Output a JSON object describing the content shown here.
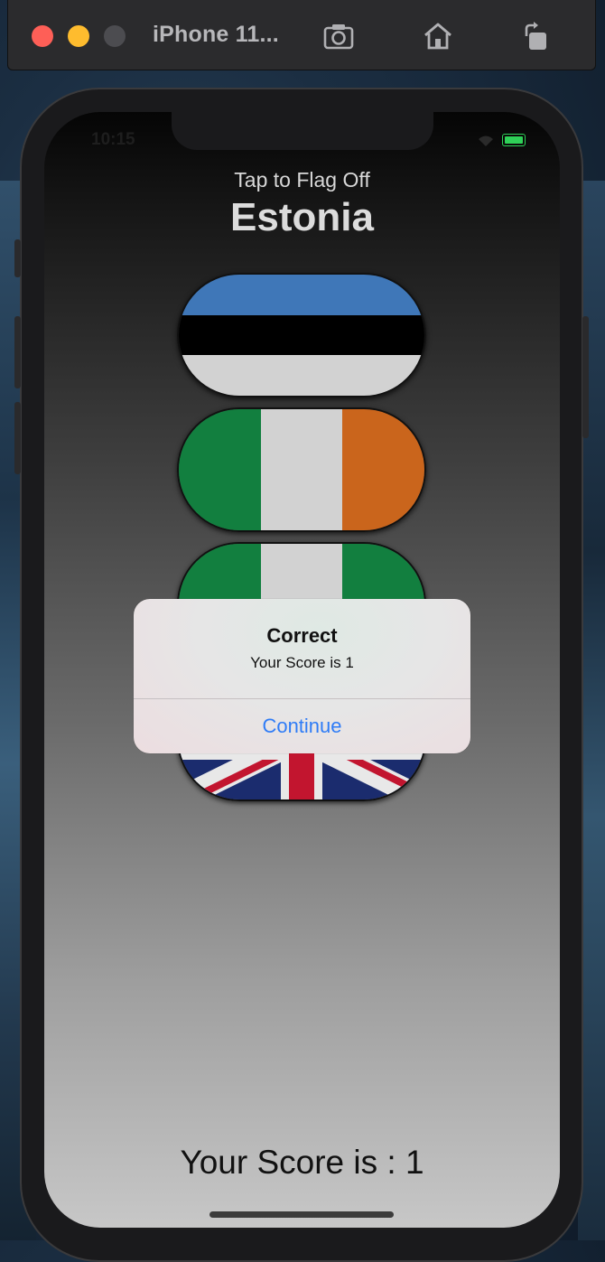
{
  "simulator": {
    "title": "iPhone 11...",
    "icons": [
      "screenshot-icon",
      "home-icon",
      "rotate-icon"
    ]
  },
  "status_bar": {
    "time": "10:15"
  },
  "game": {
    "prompt": "Tap to Flag Off",
    "country": "Estonia",
    "flags": [
      "Estonia",
      "Ireland",
      "Nigeria",
      "United Kingdom"
    ],
    "score_label": "Your Score is : 1"
  },
  "alert": {
    "title": "Correct",
    "message": "Your Score is 1",
    "button": "Continue"
  },
  "colors": {
    "alert_button": "#2f7cf6",
    "estonia_blue": "#3f77b8",
    "ireland_green": "#127f3f",
    "ireland_orange": "#ca651c",
    "uk_blue": "#1b2c6e",
    "uk_red": "#c2152f"
  }
}
